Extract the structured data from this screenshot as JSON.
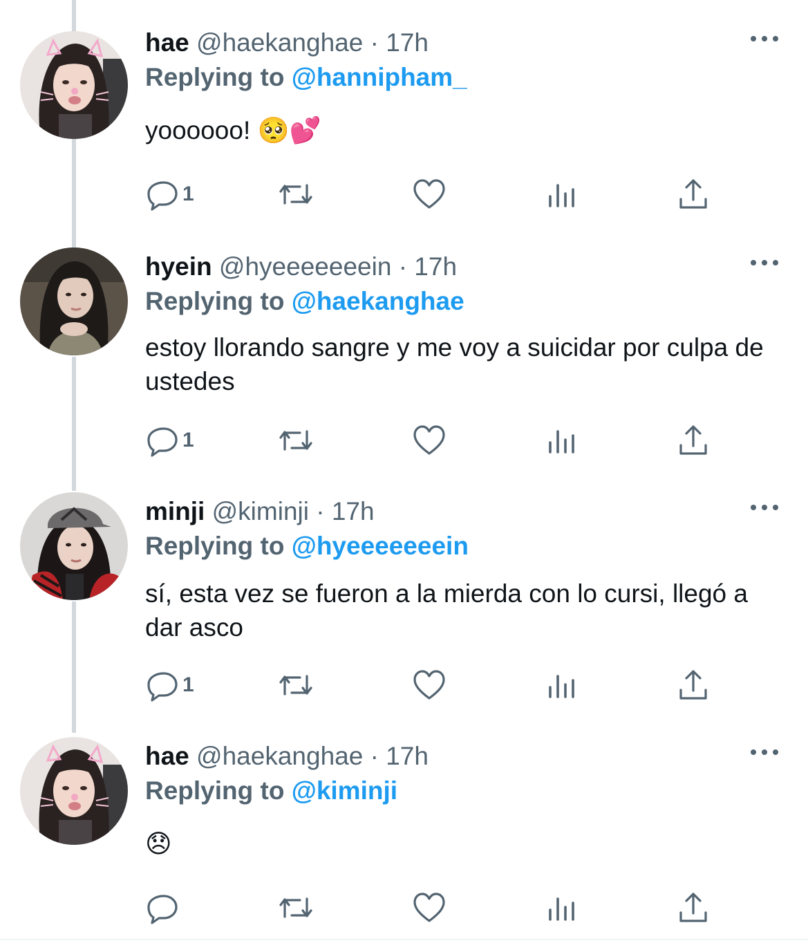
{
  "tweets": [
    {
      "name": "hae",
      "handle": "@haekanghae",
      "separator": "·",
      "time": "17h",
      "replying_label": "Replying to",
      "replying_to": "@hannipham_",
      "text": "yoooooo! 🥺💕",
      "reply_count": "1",
      "avatar": "hae-avatar"
    },
    {
      "name": "hyein",
      "handle": "@hyeeeeeeein",
      "separator": "·",
      "time": "17h",
      "replying_label": "Replying to",
      "replying_to": "@haekanghae",
      "text": "estoy llorando sangre y me voy a suicidar por culpa de ustedes",
      "reply_count": "1",
      "avatar": "hyein-avatar"
    },
    {
      "name": "minji",
      "handle": "@kiminji",
      "separator": "·",
      "time": "17h",
      "replying_label": "Replying to",
      "replying_to": "@hyeeeeeeein",
      "text": "sí, esta vez se fueron a la mierda con lo cursi, llegó a dar asco",
      "reply_count": "1",
      "avatar": "minji-avatar"
    },
    {
      "name": "hae",
      "handle": "@haekanghae",
      "separator": "·",
      "time": "17h",
      "replying_label": "Replying to",
      "replying_to": "@kiminji",
      "text": "😞",
      "reply_count": "",
      "avatar": "hae-avatar"
    }
  ],
  "icons": {
    "reply": "reply-icon",
    "retweet": "retweet-icon",
    "like": "heart-icon",
    "views": "views-icon",
    "share": "share-icon",
    "more": "more-icon"
  },
  "colors": {
    "text": "#0f1419",
    "secondary": "#536471",
    "link": "#1d9bf0",
    "thread_line": "#d3d8dd"
  }
}
